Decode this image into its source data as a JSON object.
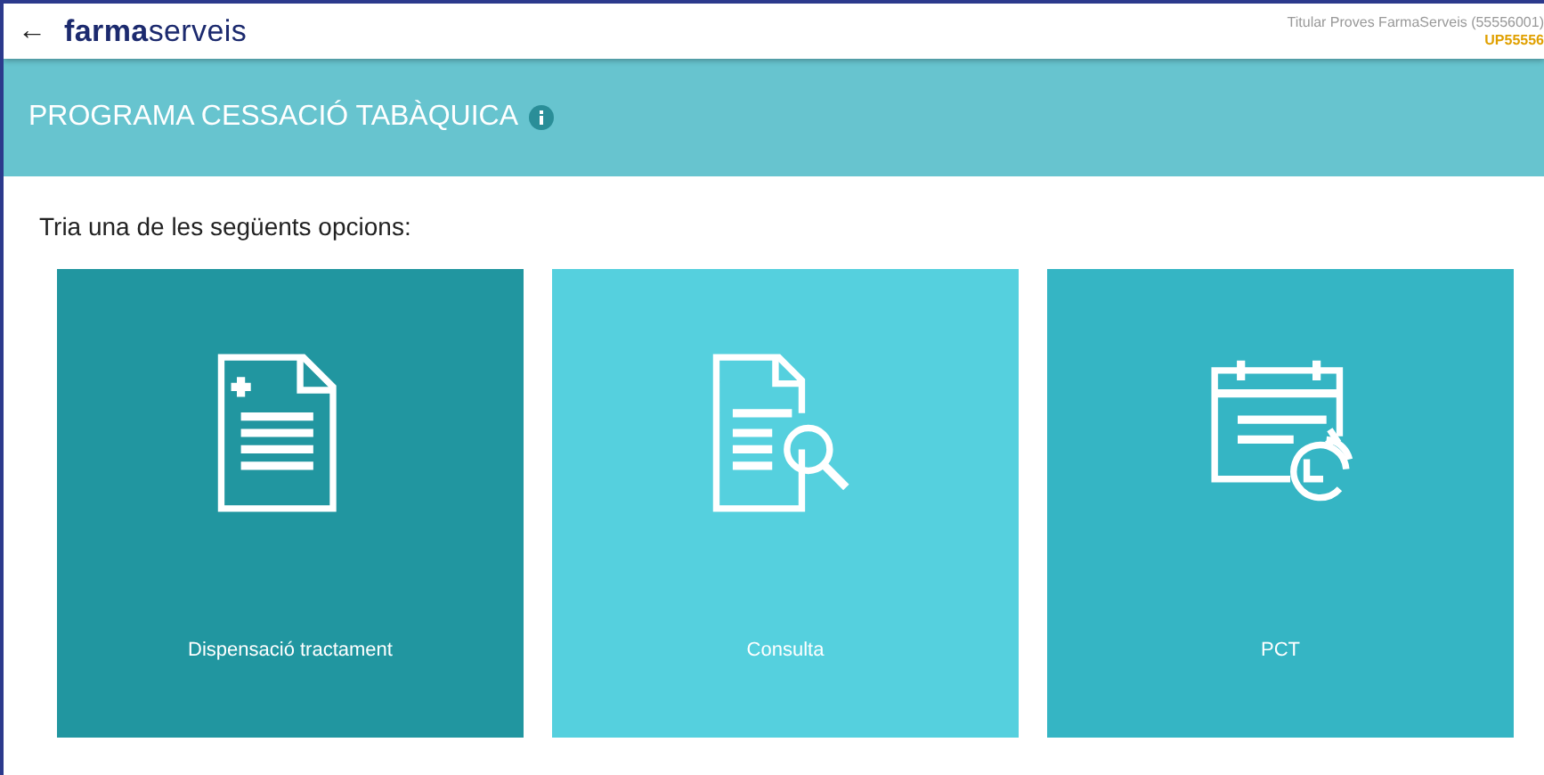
{
  "header": {
    "back": "←",
    "logo": "**farma**serveis",
    "user": "Titular Proves FarmaServeis (55556001)",
    "code": "UP55556"
  },
  "banner": {
    "title": "PROGRAMA CESSACIÓ TABÀQUICA"
  },
  "prompt": "Tria una de les següents opcions:",
  "options": [
    {
      "label": "Dispensació tractament",
      "kind": "document-plus",
      "color": "#2196a0"
    },
    {
      "label": "Consulta",
      "kind": "document-search",
      "color": "#55d0de"
    },
    {
      "label": "PCT",
      "kind": "calendar-clock",
      "color": "#35b5c4"
    }
  ]
}
